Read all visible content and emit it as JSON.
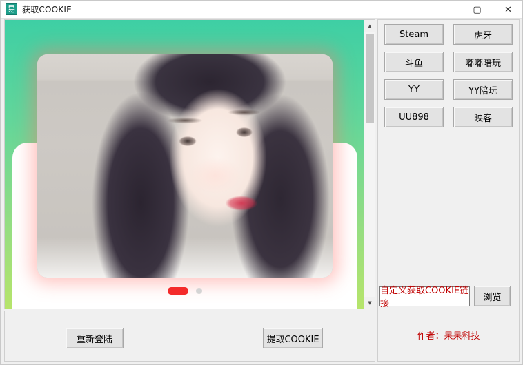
{
  "window": {
    "title": "获取COOKIE",
    "icon": "易",
    "controls": {
      "minimize": "—",
      "maximize": "▢",
      "close": "✕"
    }
  },
  "webview": {
    "carousel": {
      "dots": [
        {
          "state": "active"
        },
        {
          "state": "inactive"
        }
      ]
    },
    "scrollbar": {
      "up_arrow": "▲",
      "down_arrow": "▼"
    }
  },
  "right_panel": {
    "site_buttons": [
      {
        "label": "Steam"
      },
      {
        "label": "虎牙"
      },
      {
        "label": "斗鱼"
      },
      {
        "label": "嘟嘟陪玩"
      },
      {
        "label": "YY"
      },
      {
        "label": "YY陪玩"
      },
      {
        "label": "UU898"
      },
      {
        "label": "映客"
      }
    ],
    "url_input_value": "自定义获取COOKIE链接",
    "browse_label": "浏览",
    "author_text": "作者：呆呆科技"
  },
  "bottom_bar": {
    "relogin_label": "重新登陆",
    "extract_label": "提取COOKIE"
  },
  "colors": {
    "accent_green_top": "#3ecfa4",
    "accent_green_bottom": "#b6e46b",
    "accent_red": "#c00000",
    "dot_active": "#f42a2a",
    "title_icon_bg": "#1d9e8a"
  }
}
